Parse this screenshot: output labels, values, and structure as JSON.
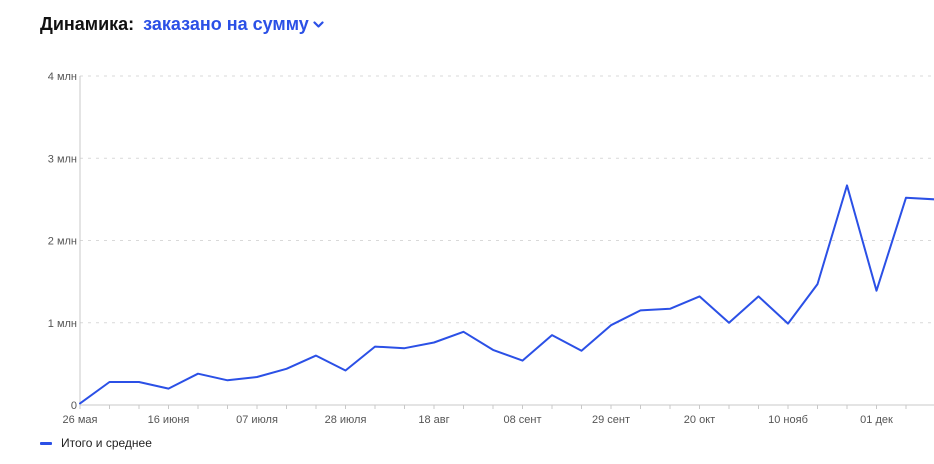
{
  "header": {
    "title": "Динамика:",
    "metric_selected": "заказано на сумму"
  },
  "icons": {
    "dropdown": "chevron-down-icon"
  },
  "colors": {
    "accent": "#2b50e6",
    "line": "#2b50e6",
    "grid": "#d9d9d9",
    "axis": "#c8c8c8"
  },
  "chart_data": {
    "type": "line",
    "grid": true,
    "legend_position": "bottom-left",
    "ylim": [
      0,
      4000000
    ],
    "y_ticks": [
      {
        "value": 0,
        "label": "0"
      },
      {
        "value": 1000000,
        "label": "1 млн"
      },
      {
        "value": 2000000,
        "label": "2 млн"
      },
      {
        "value": 3000000,
        "label": "3 млн"
      },
      {
        "value": 4000000,
        "label": "4 млн"
      }
    ],
    "x_labels": [
      {
        "index": 0,
        "label": "26 мая"
      },
      {
        "index": 3,
        "label": "16 июня"
      },
      {
        "index": 6,
        "label": "07 июля"
      },
      {
        "index": 9,
        "label": "28 июля"
      },
      {
        "index": 12,
        "label": "18 авг"
      },
      {
        "index": 15,
        "label": "08 сент"
      },
      {
        "index": 18,
        "label": "29 сент"
      },
      {
        "index": 21,
        "label": "20 окт"
      },
      {
        "index": 24,
        "label": "10 нояб"
      },
      {
        "index": 27,
        "label": "01 дек"
      }
    ],
    "series": [
      {
        "name": "Итого и среднее",
        "values": [
          20000,
          280000,
          280000,
          200000,
          380000,
          300000,
          340000,
          440000,
          600000,
          420000,
          710000,
          690000,
          760000,
          890000,
          670000,
          540000,
          850000,
          660000,
          970000,
          1150000,
          1170000,
          1320000,
          1000000,
          1320000,
          990000,
          1470000,
          2670000,
          1390000,
          2520000,
          2500000
        ]
      }
    ]
  }
}
